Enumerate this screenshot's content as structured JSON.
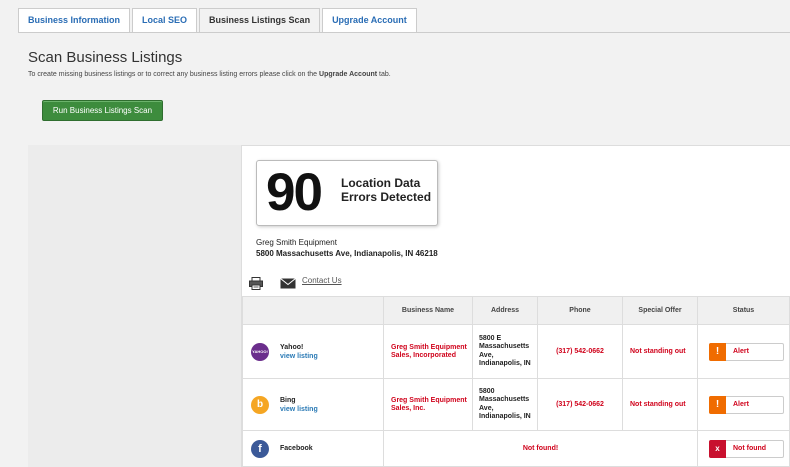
{
  "tabs": [
    {
      "label": "Business Information"
    },
    {
      "label": "Local SEO"
    },
    {
      "label": "Business Listings Scan"
    },
    {
      "label": "Upgrade Account"
    }
  ],
  "page": {
    "title": "Scan Business Listings",
    "subtitle_before": "To create missing business listings or to correct any business listing errors please click on the ",
    "subtitle_bold": "Upgrade Account",
    "subtitle_after": " tab.",
    "run_button": "Run Business Listings Scan"
  },
  "scan": {
    "error_count": "90",
    "error_text": "Location Data Errors Detected",
    "business_name": "Greg Smith Equipment",
    "business_address": "5800 Massachusetts Ave, Indianapolis, IN 46218",
    "contact_link": "Contact Us"
  },
  "table": {
    "headers": [
      "",
      "Business Name",
      "Address",
      "Phone",
      "Special Offer",
      "Status"
    ],
    "rows": [
      {
        "source": "Yahoo!",
        "link": "view listing",
        "logo_text": "YAHOO!",
        "name": "Greg Smith Equipment Sales, Incorporated",
        "address": "5800 E Massachusetts Ave, Indianapolis, IN",
        "phone": "(317) 542-0662",
        "offer": "Not standing out",
        "status": "Alert",
        "status_icon": "!"
      },
      {
        "source": "Bing",
        "link": "view listing",
        "logo_text": "b",
        "name": "Greg Smith Equipment Sales, Inc.",
        "address": "5800 Massachusetts Ave, Indianapolis, IN",
        "phone": "(317) 542-0662",
        "offer": "Not standing out",
        "status": "Alert",
        "status_icon": "!"
      },
      {
        "source": "Facebook",
        "logo_text": "f",
        "not_found": "Not found!",
        "status": "Not found",
        "status_icon": "x"
      }
    ]
  },
  "colors": {
    "tab_link": "#2a6db5",
    "run_button": "#3d8c3d",
    "error_red": "#d0021b",
    "alert_orange": "#f06c00",
    "notfound_red": "#c8102e",
    "yahoo_purple": "#6b2e8c",
    "bing_orange": "#f5a623",
    "facebook_blue": "#3b5998"
  },
  "icons": {
    "print": "printer-icon",
    "mail": "envelope-icon"
  }
}
